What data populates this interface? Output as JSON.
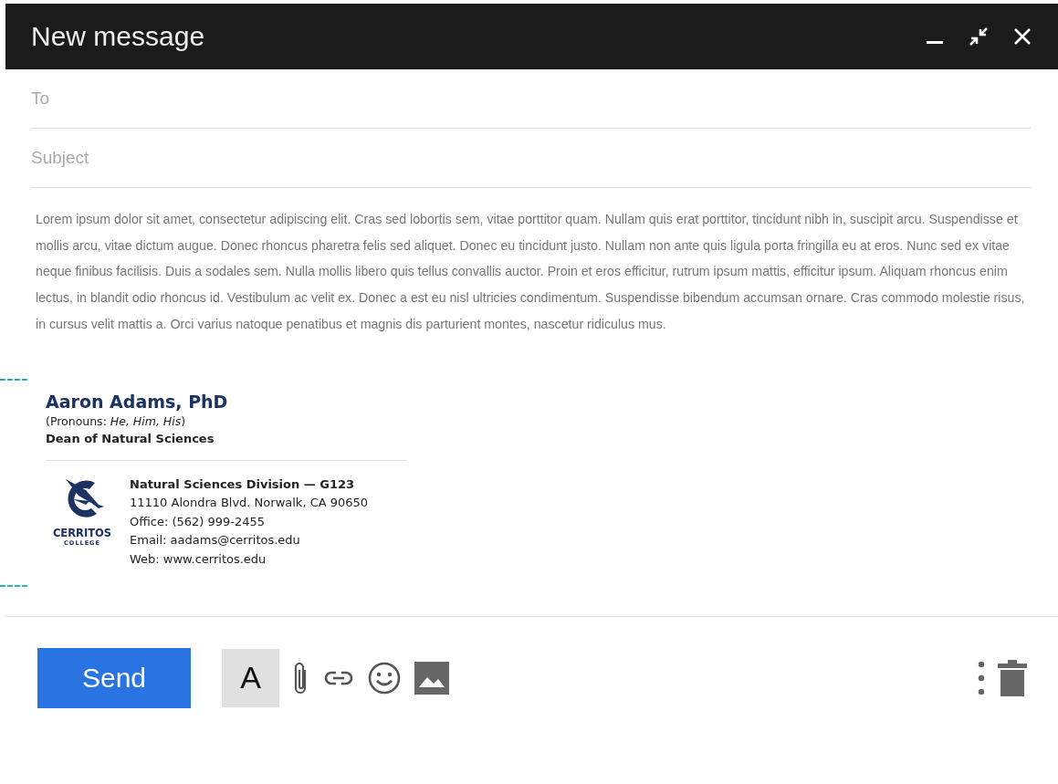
{
  "window": {
    "title": "New message"
  },
  "fields": [
    {
      "placeholder": "To"
    },
    {
      "placeholder": "Subject"
    }
  ],
  "body": "Lorem ipsum dolor sit amet, consectetur adipiscing elit. Cras sed lobortis sem, vitae porttitor quam. Nullam quis erat porttitor, tincidunt nibh in, suscipit arcu. Suspendisse et mollis arcu, vitae dictum augue. Donec rhoncus pharetra felis sed aliquet. Donec eu tincidunt justo. Nullam non ante quis ligula porta fringilla eu at eros. Nunc sed ex vitae neque finibus facilisis. Duis a sodales sem. Nulla mollis libero quis tellus convallis auctor. Proin et eros efficitur, rutrum ipsum mattis, efficitur ipsum. Aliquam rhoncus enim lectus, in blandit odio rhoncus id. Vestibulum ac velit ex. Donec a est eu nisl ultricies condimentum. Suspendisse bibendum accumsan ornare. Cras commodo molestie risus, in cursus velit mattis a. Orci varius natoque penatibus et magnis dis parturient montes, nascetur ridiculus mus.",
  "signature": {
    "name": "Aaron Adams, PhD",
    "pronouns": "(Pronouns: *He, Him, His*)",
    "role": "Dean of Natural Sciences",
    "logo": {
      "line_1": "CERRITOS",
      "line_2": "COLLEGE"
    },
    "details": [
      {
        "kind": "heading",
        "text": "Natural Sciences Division — G123"
      },
      {
        "kind": "plain",
        "text": "11110 Alondra Blvd. Norwalk, CA 90650"
      },
      {
        "kind": "plain",
        "text": "Office: (562) 999-2455"
      },
      {
        "kind": "plain",
        "text": "Email: aadams@cerritos.edu"
      },
      {
        "kind": "plain",
        "text": "Web: www.cerritos.edu"
      }
    ]
  },
  "toolbar": {
    "send": "Send",
    "format": {
      "label": "A",
      "selected": true
    }
  }
}
